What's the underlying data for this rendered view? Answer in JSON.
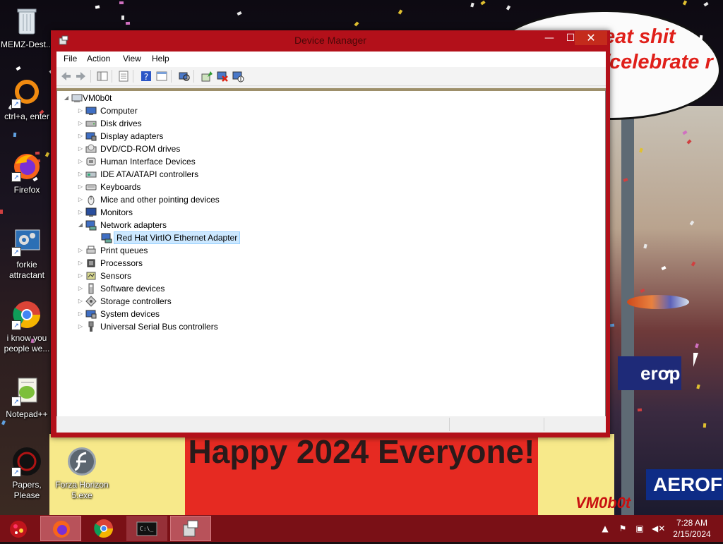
{
  "window": {
    "title": "Device Manager",
    "minimize": "—",
    "maximize": "☐",
    "close": "✕"
  },
  "menu": [
    "File",
    "Action",
    "View",
    "Help"
  ],
  "toolbar_icons": [
    "back-icon",
    "forward-icon",
    "properties-view-icon",
    "show-hidden-icon",
    "help-icon",
    "resources-icon",
    "scan-hardware-icon",
    "update-driver-icon",
    "uninstall-device-icon",
    "disable-device-icon"
  ],
  "tree": {
    "root": "VM0b0t",
    "collapse_glyph": "◢",
    "expand_glyph": "▷",
    "categories": [
      {
        "label": "Computer",
        "icon": "computer-icon"
      },
      {
        "label": "Disk drives",
        "icon": "disk-drive-icon"
      },
      {
        "label": "Display adapters",
        "icon": "display-adapter-icon"
      },
      {
        "label": "DVD/CD-ROM drives",
        "icon": "dvd-drive-icon"
      },
      {
        "label": "Human Interface Devices",
        "icon": "hid-icon"
      },
      {
        "label": "IDE ATA/ATAPI controllers",
        "icon": "ide-controller-icon"
      },
      {
        "label": "Keyboards",
        "icon": "keyboard-icon"
      },
      {
        "label": "Mice and other pointing devices",
        "icon": "mouse-icon"
      },
      {
        "label": "Monitors",
        "icon": "monitor-icon"
      },
      {
        "label": "Network adapters",
        "icon": "network-adapter-icon",
        "expanded": true
      },
      {
        "label": "Red Hat VirtIO Ethernet Adapter",
        "icon": "ethernet-adapter-icon",
        "child": true,
        "selected": true
      },
      {
        "label": "Print queues",
        "icon": "printer-icon"
      },
      {
        "label": "Processors",
        "icon": "processor-icon"
      },
      {
        "label": "Sensors",
        "icon": "sensor-icon"
      },
      {
        "label": "Software devices",
        "icon": "software-device-icon"
      },
      {
        "label": "Storage controllers",
        "icon": "storage-controller-icon"
      },
      {
        "label": "System devices",
        "icon": "system-devices-icon"
      },
      {
        "label": "Universal Serial Bus controllers",
        "icon": "usb-icon"
      }
    ]
  },
  "desktop_icons": [
    {
      "label": "MEMZ-Dest...",
      "icon": "recycle-bin-icon"
    },
    {
      "label": "ctrl+a, enter",
      "icon": "ring-icon"
    },
    {
      "label": "Firefox",
      "icon": "firefox-icon"
    },
    {
      "label": "forkie attractant",
      "icon": "settings-shortcut-icon"
    },
    {
      "label": "i know you people we...",
      "icon": "chrome-icon"
    },
    {
      "label": "Notepad++",
      "icon": "notepadpp-icon"
    },
    {
      "label": "Papers, Please",
      "icon": "papers-please-icon"
    },
    {
      "label": "Forza Horizon 5.exe",
      "icon": "flash-icon"
    }
  ],
  "wallpaper": {
    "bubble_text": "eat shit /celebrate r",
    "banner_text": "Happy 2024 Everyone!",
    "sign1": "erop",
    "sign2": "AEROFOS",
    "tag": "VM0b0t"
  },
  "taskbar": {
    "time": "7:28 AM",
    "date": "2/15/2024",
    "buttons": [
      "firefox-taskbar-icon",
      "chrome-taskbar-icon",
      "cmd-taskbar-icon",
      "device-manager-taskbar-icon"
    ]
  },
  "colors": {
    "window_frame": "#b3101a",
    "taskbar": "#7a1016",
    "selection": "#cce8ff"
  }
}
